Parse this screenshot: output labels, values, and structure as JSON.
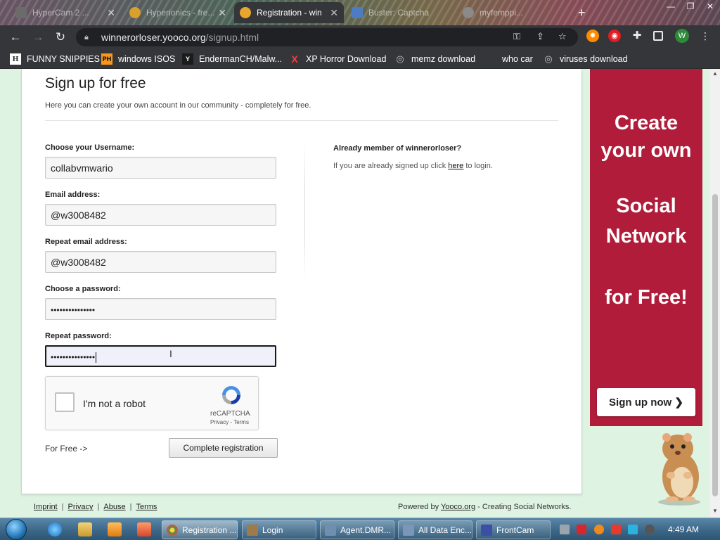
{
  "browser": {
    "tabs": [
      {
        "title": "HyperCam 2 ...",
        "active": false,
        "color": "#6b6b6b"
      },
      {
        "title": "Hyperionics - fre...",
        "active": false,
        "color": "#d9a02b"
      },
      {
        "title": "Registration - win",
        "active": true,
        "color": "#e8a72c"
      },
      {
        "title": "Buster: Captcha",
        "active": false,
        "color": "#4d7cc4"
      },
      {
        "title": "myfemppi...",
        "active": false,
        "color": "#8a8a8a"
      }
    ],
    "url_domain": "winnerorloser.yooco.org",
    "url_path": "/signup.html",
    "profile_initial": "W",
    "bookmarks": [
      {
        "label": "FUNNY SNIPPIES",
        "icon": "H"
      },
      {
        "label": "windows ISOS",
        "icon": "PH"
      },
      {
        "label": "EndermanCH/Malw...",
        "icon": "Y"
      },
      {
        "label": "XP Horror Download",
        "icon": "X"
      },
      {
        "label": "memz download",
        "icon": "globe"
      },
      {
        "label": "who car",
        "icon": ""
      },
      {
        "label": "viruses download",
        "icon": "globe"
      }
    ]
  },
  "form": {
    "title": "Sign up for free",
    "description": "Here you can create your own account in our community - completely for free.",
    "username_label": "Choose your Username:",
    "username_value": "collabvmwario",
    "email_label": "Email address:",
    "email_value": "@w3008482",
    "email_repeat_label": "Repeat email address:",
    "email_repeat_value": "@w3008482",
    "password_label": "Choose a password:",
    "password_value": "•••••••••••••••",
    "password_repeat_label": "Repeat password:",
    "password_repeat_value": "•••••••••••••••",
    "captcha_label": "I'm not a robot",
    "captcha_brand": "reCAPTCHA",
    "captcha_terms": "Privacy - Terms",
    "for_free": "For Free ->",
    "submit_label": "Complete registration"
  },
  "sidebar": {
    "heading": "Already member of winnerorloser?",
    "text_before": "If you are already signed up click ",
    "link": "here",
    "text_after": " to login."
  },
  "ad": {
    "line1": "Create",
    "line2": "your own",
    "line3": "Social",
    "line4": "Network",
    "line5": "for Free!",
    "button": "Sign up now ❯"
  },
  "footer": {
    "links": [
      "Imprint",
      "Privacy",
      "Abuse",
      "Terms"
    ],
    "powered_by": "Powered by ",
    "powered_link": "Yooco.org",
    "powered_rest": " - Creating Social Networks."
  },
  "taskbar": {
    "windows": [
      {
        "label": "Registration ...",
        "active": true,
        "color": "#e34b3b"
      },
      {
        "label": "Login",
        "active": false,
        "color": "#a07b4a"
      },
      {
        "label": "Agent.DMR...",
        "active": false,
        "color": "#6f8fb0"
      },
      {
        "label": "All Data Enc...",
        "active": false,
        "color": "#7a96b8"
      },
      {
        "label": "FrontCam",
        "active": false,
        "color": "#3c4fa6"
      }
    ],
    "clock": "4:49 AM"
  }
}
